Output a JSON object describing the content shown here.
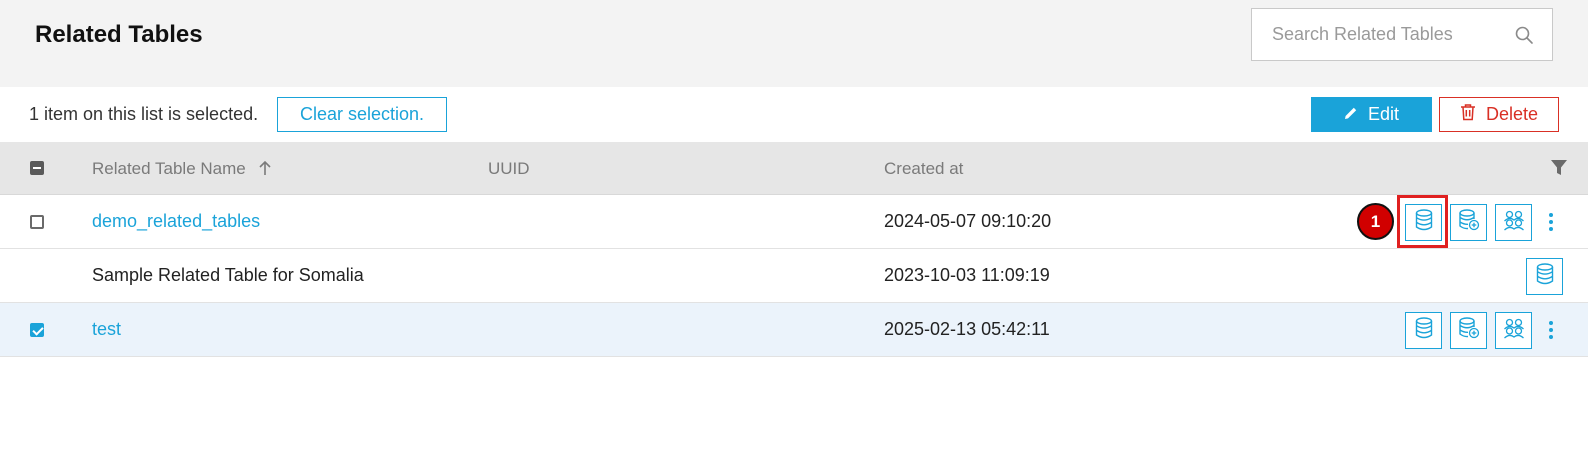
{
  "header": {
    "title": "Related Tables",
    "search": {
      "placeholder": "Search Related Tables",
      "value": ""
    }
  },
  "selection_bar": {
    "text": "1 item on this list is selected.",
    "clear_label": "Clear selection.",
    "edit_label": "Edit",
    "delete_label": "Delete"
  },
  "table": {
    "columns": [
      "Related Table Name",
      "UUID",
      "Created at"
    ],
    "sort": {
      "column": "Related Table Name",
      "direction": "ascending"
    },
    "rows": [
      {
        "name": "demo_related_tables",
        "uuid": "",
        "created_at": "2024-05-07 09:10:20",
        "checked": false,
        "link": true
      },
      {
        "name": "Sample Related Table for Somalia",
        "uuid": "",
        "created_at": "2023-10-03 11:09:19",
        "checked": null,
        "link": false
      },
      {
        "name": "test",
        "uuid": "",
        "created_at": "2025-02-13 05:42:11",
        "checked": true,
        "link": true
      }
    ]
  },
  "annotation": {
    "step_number": "1"
  },
  "colors": {
    "accent": "#1aa3d9",
    "danger": "#d93025",
    "header_bg": "#f3f3f3",
    "table_header_bg": "#e6e6e6",
    "selected_row_bg": "#ebf3fb"
  },
  "icons": [
    "search-icon",
    "pencil-icon",
    "trash-icon",
    "sort-arrow-up-icon",
    "filter-icon",
    "database-icon",
    "database-add-icon",
    "users-icon",
    "kebab-menu-icon"
  ]
}
